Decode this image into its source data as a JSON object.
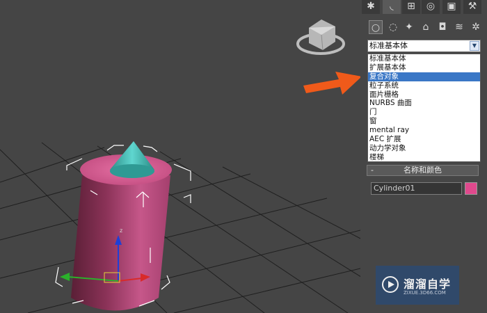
{
  "command_panel": {
    "tabs": [
      "create-tab",
      "modify-tab",
      "hierarchy-tab",
      "motion-tab",
      "display-tab",
      "utilities-tab"
    ],
    "geometry_buttons": [
      "geometry",
      "shapes",
      "lights",
      "cameras",
      "helpers",
      "space-warps",
      "systems"
    ],
    "category_selected": "标准基本体",
    "dropdown_items": [
      "标准基本体",
      "扩展基本体",
      "复合对象",
      "粒子系统",
      "面片栅格",
      "NURBS 曲面",
      "门",
      "窗",
      "mental ray",
      "AEC 扩展",
      "动力学对象",
      "楼梯"
    ],
    "highlighted_index": 2,
    "rollout": {
      "toggle": "-",
      "title": "名称和颜色",
      "object_name": "Cylinder01",
      "object_color": "#e0498d"
    }
  },
  "watermark": {
    "title": "溜溜自学",
    "url": "ZIXUE.3D66.COM"
  },
  "colors": {
    "viewport_bg": "#454545",
    "cylinder": "#c4507e",
    "cone": "#3fb7b0",
    "selection_highlight": "#3a77c6",
    "arrow": "#f05a1a"
  }
}
